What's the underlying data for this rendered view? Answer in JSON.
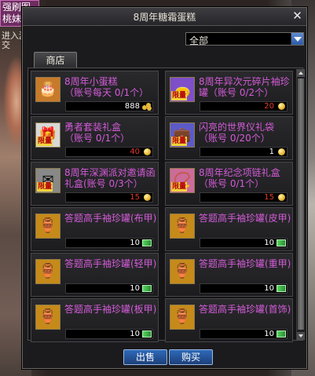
{
  "overlay": {
    "line1": "强刷图",
    "line2": "桃妹子"
  },
  "side_text": {
    "line1": "进入游戏",
    "line2": "交"
  },
  "window": {
    "title": "8周年糖霜蛋糕"
  },
  "filter": {
    "selected": "全部"
  },
  "tab": {
    "label": "商店"
  },
  "badge_text": "限量",
  "items": [
    {
      "name": "8周年小蛋糕\n（账号每天 0/1个）",
      "price": "888",
      "currency": "coins",
      "limited": false,
      "icon": "cake-icon",
      "num_color": "#ffffff"
    },
    {
      "name": "8周年异次元碎片袖珍罐（账号 0/2个）",
      "price": "20",
      "currency": "coin",
      "limited": true,
      "icon": "pouch-icon",
      "num_color": "#e23a2a"
    },
    {
      "name": "勇者套装礼盒\n（账号 0/1个）",
      "price": "40",
      "currency": "coin",
      "limited": true,
      "icon": "giftbox-icon",
      "num_color": "#e23a2a"
    },
    {
      "name": "闪亮的世界仪礼袋\n（账号 0/20个）",
      "price": "1",
      "currency": "coin",
      "limited": true,
      "icon": "bag-icon",
      "num_color": "#ffffff"
    },
    {
      "name": "8周年深渊派对邀请函礼盒(账号 0/3个）",
      "price": "15",
      "currency": "coin",
      "limited": true,
      "icon": "invite-box-icon",
      "num_color": "#e23a2a"
    },
    {
      "name": "8周年纪念项链礼盒\n（账号 0/1个）",
      "price": "15",
      "currency": "coin",
      "limited": true,
      "icon": "necklace-box-icon",
      "num_color": "#e23a2a"
    },
    {
      "name": "答题高手袖珍罐(布甲)",
      "price": "10",
      "currency": "ticket",
      "limited": false,
      "icon": "jar-icon",
      "num_color": "#ffffff"
    },
    {
      "name": "答题高手袖珍罐(皮甲)",
      "price": "10",
      "currency": "ticket",
      "limited": false,
      "icon": "jar-icon",
      "num_color": "#ffffff"
    },
    {
      "name": "答题高手袖珍罐(轻甲)",
      "price": "10",
      "currency": "ticket",
      "limited": false,
      "icon": "jar-icon",
      "num_color": "#ffffff"
    },
    {
      "name": "答题高手袖珍罐(重甲)",
      "price": "10",
      "currency": "ticket",
      "limited": false,
      "icon": "jar-icon",
      "num_color": "#ffffff"
    },
    {
      "name": "答题高手袖珍罐(板甲)",
      "price": "10",
      "currency": "ticket",
      "limited": false,
      "icon": "jar-icon",
      "num_color": "#ffffff"
    },
    {
      "name": "答题高手袖珍罐(首饰)",
      "price": "10",
      "currency": "ticket",
      "limited": false,
      "icon": "jar-icon",
      "num_color": "#ffffff"
    }
  ],
  "buttons": {
    "sell": "出售",
    "buy": "购买"
  }
}
